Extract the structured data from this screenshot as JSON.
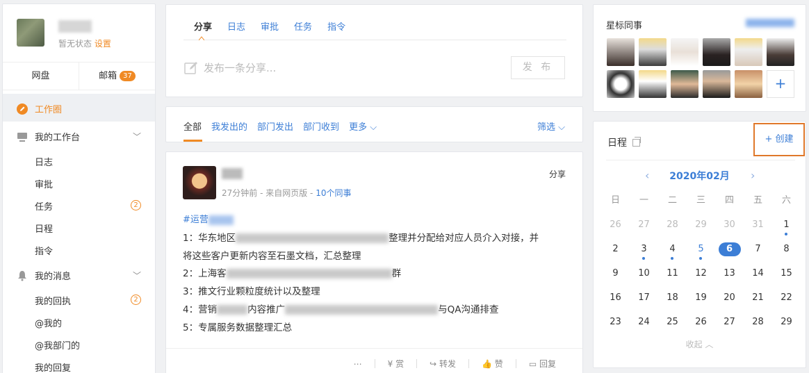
{
  "profile": {
    "status": "暂无状态",
    "settings_link": "设置"
  },
  "quick_tabs": {
    "disk": "网盘",
    "mail": "邮箱",
    "mail_count": "37"
  },
  "nav": {
    "work_circle": "工作圈",
    "workbench": "我的工作台",
    "workbench_items": [
      "日志",
      "审批",
      "任务",
      "日程",
      "指令"
    ],
    "task_badge": "2",
    "messages": "我的消息",
    "message_items": [
      "我的回执",
      "@我的",
      "@我部门的",
      "我的回复"
    ],
    "receipt_badge": "2"
  },
  "share": {
    "tabs": [
      "分享",
      "日志",
      "审批",
      "任务",
      "指令"
    ],
    "placeholder": "发布一条分享...",
    "publish": "发 布"
  },
  "filter": {
    "tabs": [
      "全部",
      "我发出的",
      "部门发出",
      "部门收到"
    ],
    "more": "更多",
    "screen": "筛选"
  },
  "post": {
    "meta_time": "27分钟前 - 来自网页版 - ",
    "meta_link": "10个同事",
    "type": "分享",
    "tag": "#运营",
    "line1_a": "1：华东地区",
    "line1_b": "整理并分配给对应人员介入对接，并",
    "line2": "将这些客户更新内容至石墨文档，汇总整理",
    "line3_a": "2：上海客",
    "line3_b": "群",
    "line4": "3：推文行业颗粒度统计以及整理",
    "line5_a": "4：营销",
    "line5_b": "内容推广",
    "line5_c": "与QA沟通排查",
    "line6": "5：专属服务数据整理汇总",
    "actions": [
      "⋯",
      "赏",
      "转发",
      "赞",
      "回复"
    ]
  },
  "colleagues": {
    "title": "星标同事",
    "add": "+"
  },
  "schedule": {
    "title": "日程",
    "create": "+ 创建",
    "month": "2020年02月",
    "weekdays": [
      "日",
      "一",
      "二",
      "三",
      "四",
      "五",
      "六"
    ],
    "weeks": [
      [
        "26",
        "27",
        "28",
        "29",
        "30",
        "31",
        "1"
      ],
      [
        "2",
        "3",
        "4",
        "5",
        "6",
        "7",
        "8"
      ],
      [
        "9",
        "10",
        "11",
        "12",
        "13",
        "14",
        "15"
      ],
      [
        "16",
        "17",
        "18",
        "19",
        "20",
        "21",
        "22"
      ],
      [
        "23",
        "24",
        "25",
        "26",
        "27",
        "28",
        "29"
      ]
    ],
    "collapse": "收起"
  }
}
